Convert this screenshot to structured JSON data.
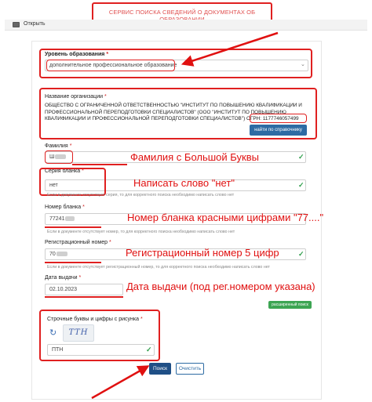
{
  "header": {
    "title": "СЕРВИС ПОИСКА СВЕДЕНИЙ О ДОКУМЕНТАХ ОБ ОБРАЗОВАНИИ"
  },
  "topbar": {
    "open_label": "Открыть"
  },
  "education_level": {
    "label": "Уровень образования",
    "required": "*",
    "value": "дополнительное профессиональное образование"
  },
  "organization": {
    "label": "Название организации",
    "required": "*",
    "line1": "ОБЩЕСТВО С ОГРАНИЧЕННОЙ ОТВЕТСТВЕННОСТЬЮ \"ИНСТИТУТ ПО ПОВЫШЕНИЮ КВАЛИФИКАЦИИ И",
    "line2": "ПРОФЕССИОНАЛЬНОЙ ПЕРЕПОДГОТОВКИ СПЕЦИАЛИСТОВ\" (ООО \"ИНСТИТУТ ПО ПОВЫШЕНИЮ",
    "line3": "КВАЛИФИКАЦИИ И ПРОФЕССИОНАЛЬНОЙ ПЕРЕПОДГОТОВКИ СПЕЦИАЛИСТОВ\")",
    "ogrn": "ОГРН: 1177746057499",
    "directory_button": "найти по справочнику"
  },
  "surname": {
    "label": "Фамилия",
    "required": "*",
    "value": "Ш"
  },
  "series": {
    "label": "Серия бланка",
    "required": "*",
    "value": "нет",
    "hint": "Если в документе отсутствует серия, то для корректного поиска необходимо написать слово нет"
  },
  "blank_number": {
    "label": "Номер бланка",
    "required": "*",
    "value": "77241",
    "hint": "Если в документе отсутствует номер, то для корректного поиска необходимо написать слово нет"
  },
  "reg_number": {
    "label": "Регистрационный номер",
    "required": "*",
    "value": "70",
    "hint": "Если в документе отсутствует регистрационный номер, то для корректного поиска необходимо написать слово нет"
  },
  "issue_date": {
    "label": "Дата выдачи",
    "required": "*",
    "value": "02.10.2023"
  },
  "extended_search_button": "расширенный поиск",
  "captcha": {
    "label": "Строчные буквы и цифры с рисунка",
    "required": "*",
    "image_text": "ТТН",
    "value": "ПТН"
  },
  "buttons": {
    "search": "Поиск",
    "clear": "Очистить"
  },
  "annotations": {
    "surname": "Фамилия с Большой Буквы",
    "series": "Написать слово \"нет\"",
    "blank_number": "Номер бланка красными цифрами \"77....\"",
    "reg_number": "Регистрационный номер 5 цифр",
    "issue_date": "Дата выдачи (под рег.номером указана)"
  },
  "colors": {
    "annotation_red": "#e01010",
    "primary_blue": "#2e6ba3",
    "dark_blue": "#1f4f86",
    "success_green": "#3da553"
  }
}
